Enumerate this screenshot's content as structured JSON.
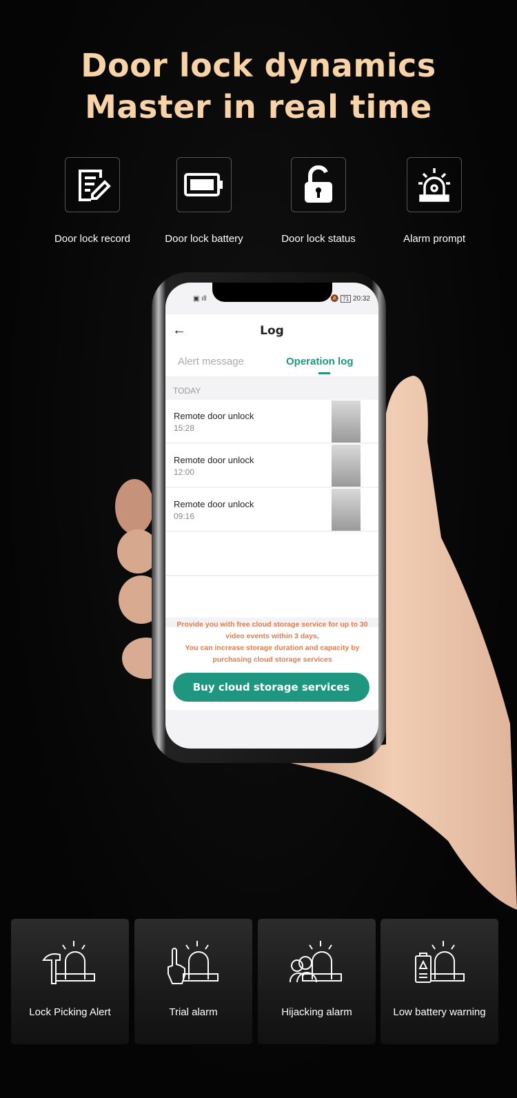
{
  "headline": {
    "line1": "Door lock dynamics",
    "line2": "Master in real time"
  },
  "features": [
    {
      "label": "Door lock record",
      "icon": "document-edit-icon"
    },
    {
      "label": "Door lock battery",
      "icon": "battery-icon"
    },
    {
      "label": "Door lock status",
      "icon": "unlocked-padlock-icon"
    },
    {
      "label": "Alarm prompt",
      "icon": "siren-icon"
    }
  ],
  "phone": {
    "status": {
      "time": "20:32",
      "battery": "71"
    },
    "title": "Log",
    "tabs": [
      {
        "label": "Alert message",
        "active": false
      },
      {
        "label": "Operation log",
        "active": true
      }
    ],
    "section": "TODAY",
    "entries": [
      {
        "name": "Remote door unlock",
        "time": "15:28"
      },
      {
        "name": "Remote door unlock",
        "time": "12:00"
      },
      {
        "name": "Remote door unlock",
        "time": "09:16"
      }
    ],
    "note": "Provide you with free cloud storage service for up to 30 video events within 3 days,\nYou can increase storage duration and capacity by purchasing cloud storage services",
    "buy_label": "Buy cloud storage services",
    "accent": "#1f9680"
  },
  "alarms": [
    {
      "label": "Lock Picking Alert",
      "icon": "hammer-siren-icon"
    },
    {
      "label": "Trial alarm",
      "icon": "finger-siren-icon"
    },
    {
      "label": "Hijacking alarm",
      "icon": "people-siren-icon"
    },
    {
      "label": "Low battery warning",
      "icon": "battery-siren-icon"
    }
  ]
}
